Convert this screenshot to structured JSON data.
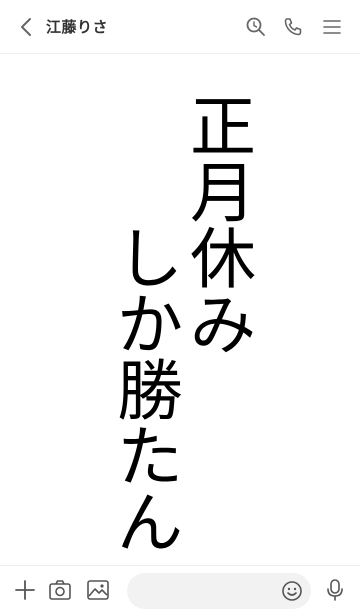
{
  "header": {
    "title": "江藤りさ",
    "back_icon": "chevron-left-icon",
    "icons": [
      "search-icon",
      "phone-icon",
      "menu-icon"
    ]
  },
  "message": {
    "columns": [
      [
        "正",
        "月",
        "休",
        "み"
      ],
      [
        "し",
        "か",
        "勝",
        "た",
        "ん"
      ]
    ]
  },
  "footer": {
    "icons": [
      "plus-icon",
      "camera-icon",
      "image-icon",
      "emoji-icon",
      "microphone-icon"
    ],
    "input_value": ""
  },
  "colors": {
    "icon": "#666666",
    "accent": "#000000",
    "input_bg": "#f2f2f2"
  }
}
